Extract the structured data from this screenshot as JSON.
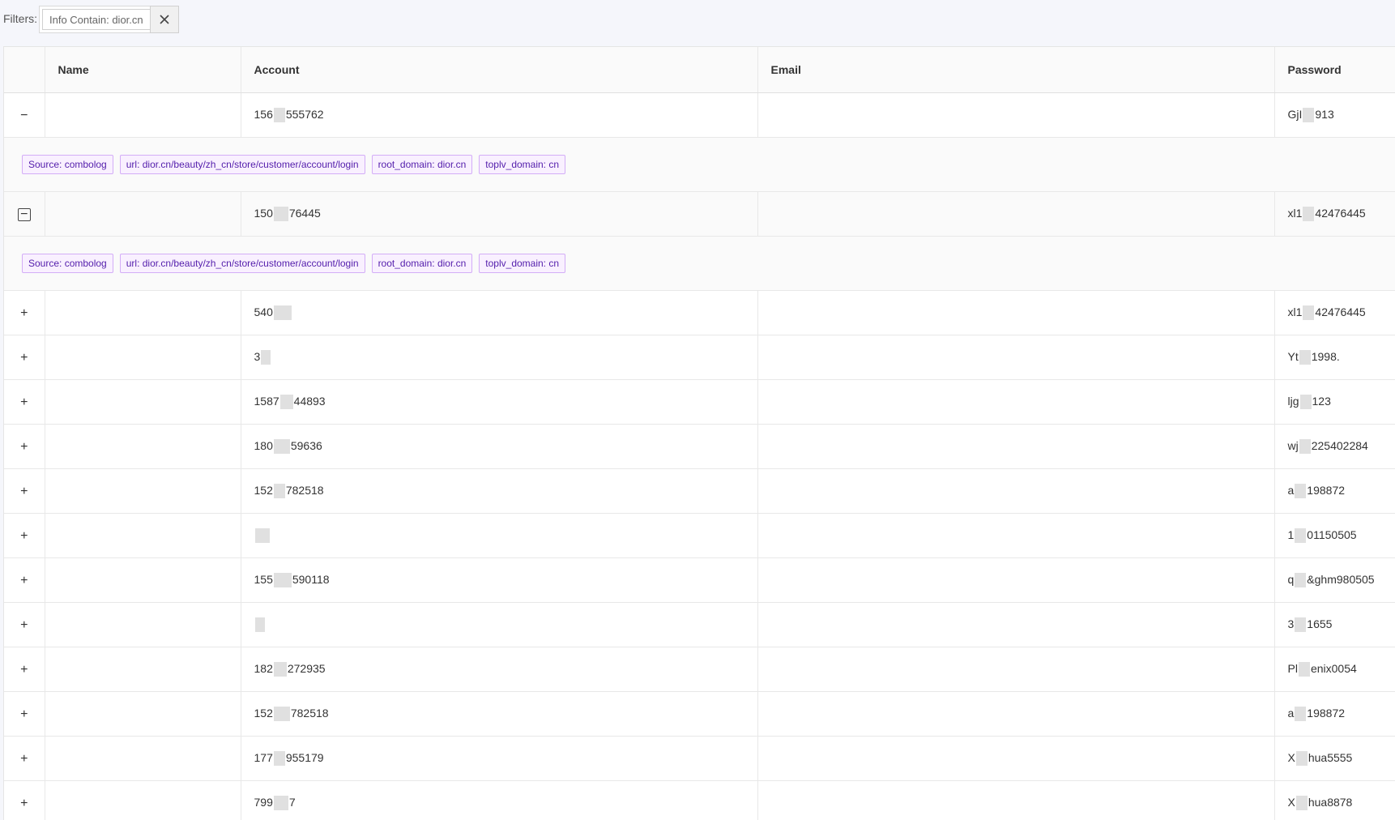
{
  "filters": {
    "label": "Filters:",
    "chip_text": "Info Contain: dior.cn",
    "close_icon": "close-icon"
  },
  "table": {
    "headers": {
      "expand": "",
      "name": "Name",
      "account": "Account",
      "email": "Email",
      "password": "Password"
    },
    "rows": [
      {
        "expand_symbol": "−",
        "expanded": true,
        "boxed": false,
        "name": "",
        "account_pre": "156",
        "account_post": "555762",
        "email": "",
        "password_pre": "GjI",
        "password_post": "913",
        "tags": [
          "Source: combolog",
          "url: dior.cn/beauty/zh_cn/store/customer/account/login",
          "root_domain: dior.cn",
          "toplv_domain: cn"
        ]
      },
      {
        "expand_symbol": "−",
        "expanded": true,
        "boxed": true,
        "name": "",
        "account_pre": "150",
        "account_post": "76445",
        "email": "",
        "password_pre": "xl1",
        "password_post": "42476445",
        "tags": [
          "Source: combolog",
          "url: dior.cn/beauty/zh_cn/store/customer/account/login",
          "root_domain: dior.cn",
          "toplv_domain: cn"
        ]
      },
      {
        "expand_symbol": "+",
        "expanded": false,
        "name": "",
        "account_pre": "540",
        "account_post": "",
        "email": "",
        "password_pre": "xl1",
        "password_post": "42476445"
      },
      {
        "expand_symbol": "+",
        "expanded": false,
        "name": "",
        "account_pre": "3",
        "account_post": "",
        "email": "",
        "password_pre": "Yt",
        "password_post": "1998."
      },
      {
        "expand_symbol": "+",
        "expanded": false,
        "name": "",
        "account_pre": "1587",
        "account_post": "44893",
        "email": "",
        "password_pre": "ljg",
        "password_post": "123"
      },
      {
        "expand_symbol": "+",
        "expanded": false,
        "name": "",
        "account_pre": "180",
        "account_post": "59636",
        "email": "",
        "password_pre": "wj",
        "password_post": "225402284"
      },
      {
        "expand_symbol": "+",
        "expanded": false,
        "name": "",
        "account_pre": "152",
        "account_post": "782518",
        "email": "",
        "password_pre": "a",
        "password_post": "198872"
      },
      {
        "expand_symbol": "+",
        "expanded": false,
        "name": "",
        "account_pre": "",
        "account_post": "",
        "email": "",
        "password_pre": "1",
        "password_post": "01150505"
      },
      {
        "expand_symbol": "+",
        "expanded": false,
        "name": "",
        "account_pre": "155",
        "account_post": "590118",
        "email": "",
        "password_pre": "q",
        "password_post": "&ghm980505"
      },
      {
        "expand_symbol": "+",
        "expanded": false,
        "name": "",
        "account_pre": "",
        "account_post": "",
        "email": "",
        "password_pre": "3",
        "password_post": "1655"
      },
      {
        "expand_symbol": "+",
        "expanded": false,
        "name": "",
        "account_pre": "182",
        "account_post": "272935",
        "email": "",
        "password_pre": "Pl",
        "password_post": "enix0054"
      },
      {
        "expand_symbol": "+",
        "expanded": false,
        "name": "",
        "account_pre": "152",
        "account_post": "782518",
        "email": "",
        "password_pre": "a",
        "password_post": "198872"
      },
      {
        "expand_symbol": "+",
        "expanded": false,
        "name": "",
        "account_pre": "177",
        "account_post": "955179",
        "email": "",
        "password_pre": "X",
        "password_post": "hua5555"
      },
      {
        "expand_symbol": "+",
        "expanded": false,
        "name": "",
        "account_pre": "799",
        "account_post": "7",
        "email": "",
        "password_pre": "X",
        "password_post": "hua8878"
      }
    ]
  }
}
